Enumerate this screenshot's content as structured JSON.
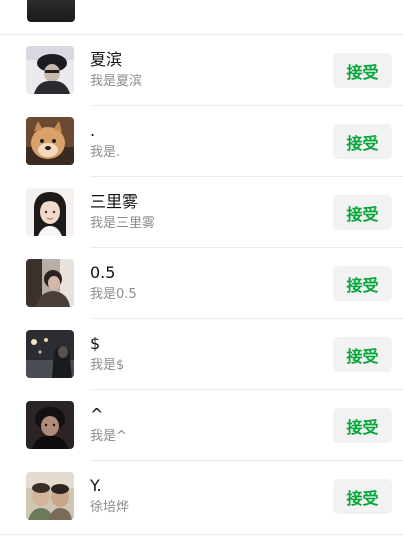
{
  "requests": [
    {
      "name": "夏滨",
      "message": "我是夏滨",
      "accept_label": "接受",
      "avatar": "avatar-person-hat"
    },
    {
      "name": ".",
      "message": "我是.",
      "accept_label": "接受",
      "avatar": "avatar-shiba-dog"
    },
    {
      "name": "三里雾",
      "message": "我是三里雾",
      "accept_label": "接受",
      "avatar": "avatar-girl-portrait"
    },
    {
      "name": "0.5",
      "message": "我是0.5",
      "accept_label": "接受",
      "avatar": "avatar-man-leaning"
    },
    {
      "name": "$",
      "message": "我是$",
      "accept_label": "接受",
      "avatar": "avatar-night-street"
    },
    {
      "name": "^",
      "message": "我是^",
      "accept_label": "接受",
      "avatar": "avatar-man-dark"
    },
    {
      "name": "Y.",
      "message": "徐培烨",
      "accept_label": "接受",
      "avatar": "avatar-friends-selfie"
    }
  ]
}
